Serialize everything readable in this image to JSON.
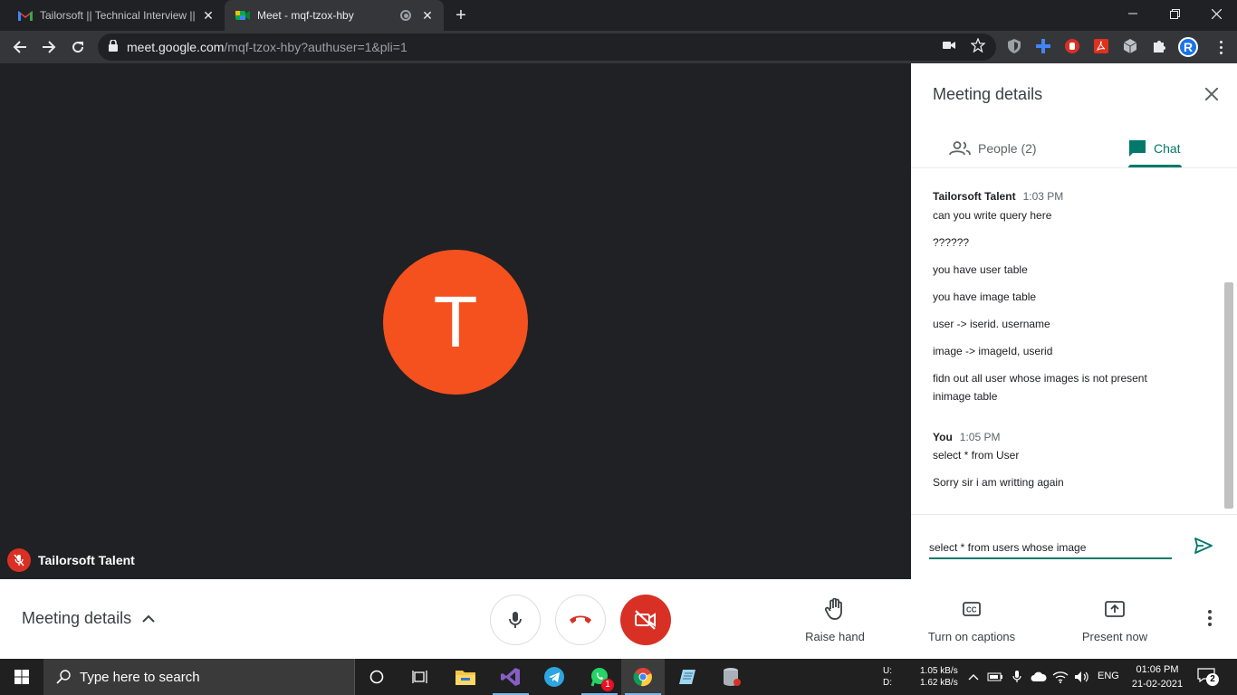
{
  "browser": {
    "tabs": [
      {
        "title": "Tailorsoft || Technical Interview ||",
        "favicon": "gmail-icon"
      },
      {
        "title": "Meet - mqf-tzox-hby",
        "favicon": "meet-icon"
      }
    ],
    "url_host": "meet.google.com",
    "url_path": "/mqf-tzox-hby?authuser=1&pli=1",
    "profile_initial": "R"
  },
  "stage": {
    "avatar_letter": "T",
    "participant_name": "Tailorsoft Talent",
    "avatar_color": "#f4511e"
  },
  "panel": {
    "title": "Meeting details",
    "tabs": {
      "people": "People (2)",
      "chat": "Chat"
    },
    "messages": [
      {
        "sender": "Tailorsoft Talent",
        "time": "1:03 PM",
        "lines": [
          "can you write query here",
          "??????",
          "you have user table",
          "you have image table",
          "user -> iserid. username",
          "image -> imageId, userid",
          "fidn out all user whose images is not present inimage table"
        ]
      },
      {
        "sender": "You",
        "time": "1:05 PM",
        "lines": [
          "select * from User",
          "Sorry sir i am writting again"
        ]
      }
    ],
    "input_value": "select * from users whose image",
    "accent": "#00796b"
  },
  "bottom": {
    "meeting_details": "Meeting details",
    "raise_hand": "Raise hand",
    "captions": "Turn on captions",
    "present": "Present now"
  },
  "taskbar": {
    "search_placeholder": "Type here to search",
    "net_up_label": "U:",
    "net_down_label": "D:",
    "net_up": "1.05 kB/s",
    "net_down": "1.62 kB/s",
    "lang": "ENG",
    "time": "01:06 PM",
    "date": "21-02-2021",
    "whatsapp_badge": "1",
    "notification_count": "2"
  }
}
